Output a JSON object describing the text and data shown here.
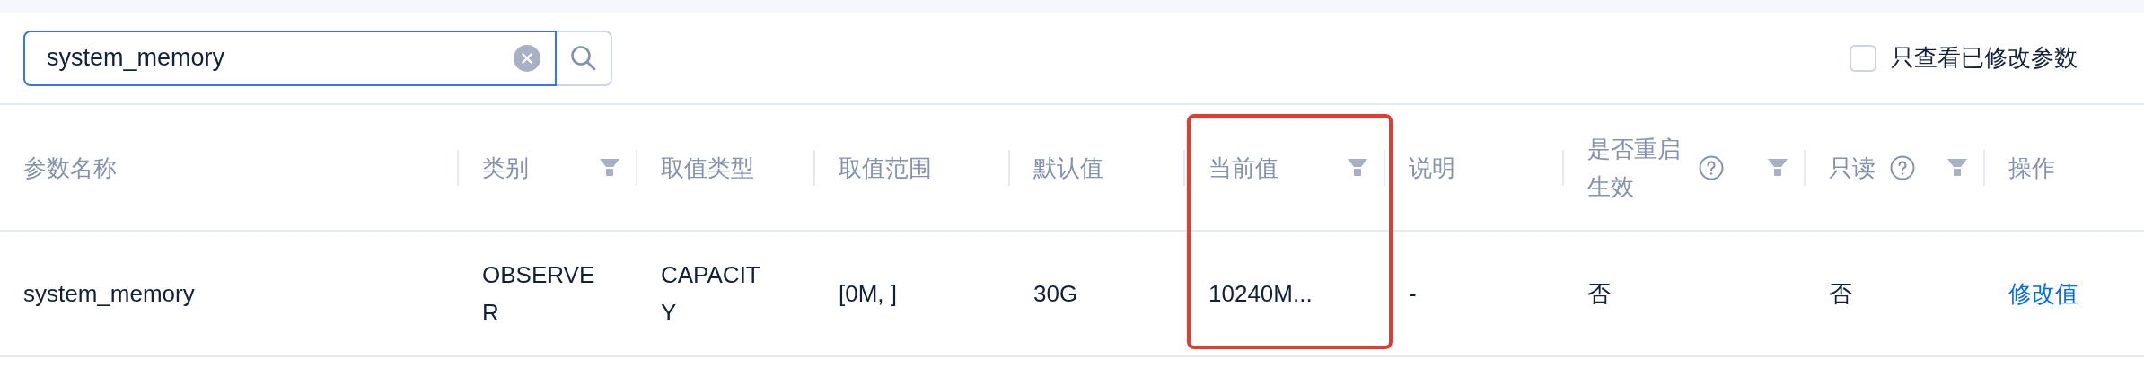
{
  "search": {
    "value": "system_memory"
  },
  "filter_checkbox": {
    "label": "只查看已修改参数",
    "checked": false
  },
  "table": {
    "columns": [
      {
        "label": "参数名称",
        "filter": false,
        "help": false,
        "highlighted": false
      },
      {
        "label": "类别",
        "filter": true,
        "help": false,
        "highlighted": false
      },
      {
        "label": "取值类型",
        "filter": false,
        "help": false,
        "highlighted": false
      },
      {
        "label": "取值范围",
        "filter": false,
        "help": false,
        "highlighted": false
      },
      {
        "label": "默认值",
        "filter": false,
        "help": false,
        "highlighted": false
      },
      {
        "label": "当前值",
        "filter": true,
        "help": false,
        "highlighted": true
      },
      {
        "label": "说明",
        "filter": false,
        "help": false,
        "highlighted": false
      },
      {
        "label": "是否重启生效",
        "filter": true,
        "help": true,
        "highlighted": false
      },
      {
        "label": "只读",
        "filter": true,
        "help": true,
        "highlighted": false
      },
      {
        "label": "操作",
        "filter": false,
        "help": false,
        "highlighted": false
      }
    ],
    "rows": [
      {
        "cells": [
          "system_memory",
          "OBSERVER",
          "CAPACITY",
          "[0M, ]",
          "30G",
          "10240M...",
          "-",
          "否",
          "否"
        ],
        "action": "修改值"
      }
    ]
  }
}
